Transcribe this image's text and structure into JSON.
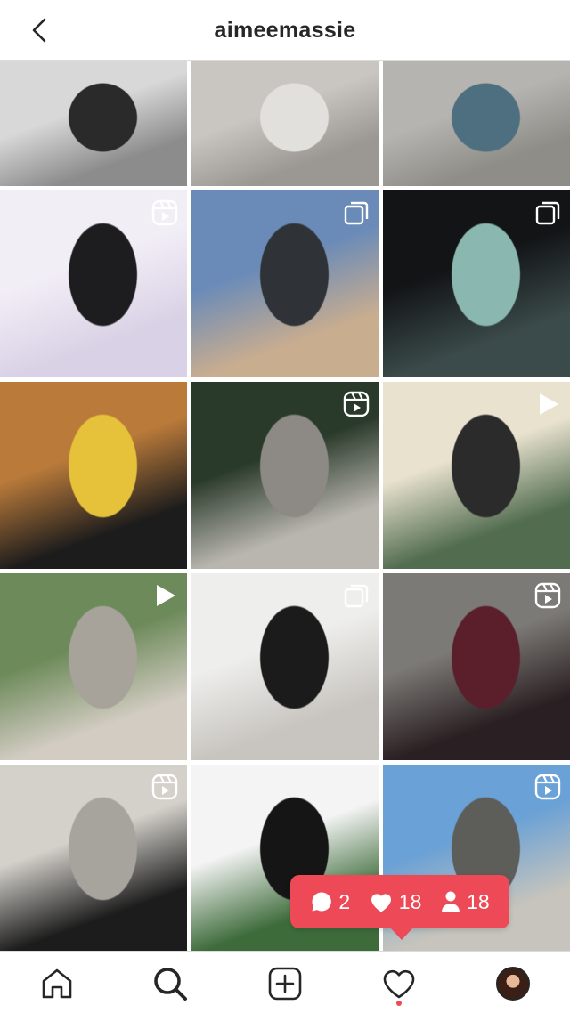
{
  "header": {
    "username": "aimeemassie",
    "back_icon": "chevron-left-icon"
  },
  "posts": [
    {
      "id": "post-1",
      "badge": "none",
      "palette": [
        "#d8d8d8",
        "#8c8c8c",
        "#2a2a2a"
      ]
    },
    {
      "id": "post-2",
      "badge": "none",
      "palette": [
        "#c9c6c1",
        "#9b9792",
        "#e2e0dc"
      ]
    },
    {
      "id": "post-3",
      "badge": "none",
      "palette": [
        "#b5b4b0",
        "#8e8d88",
        "#4d6f7f"
      ]
    },
    {
      "id": "post-4",
      "badge": "reel",
      "palette": [
        "#f2eef6",
        "#d9d2e6",
        "#1d1d1f"
      ]
    },
    {
      "id": "post-5",
      "badge": "carousel",
      "palette": [
        "#6a8bb8",
        "#c9ad8f",
        "#2f3338"
      ]
    },
    {
      "id": "post-6",
      "badge": "carousel",
      "palette": [
        "#121416",
        "#3b4a4a",
        "#8ab7b0"
      ]
    },
    {
      "id": "post-7",
      "badge": "none",
      "palette": [
        "#b97a3a",
        "#1c1c1c",
        "#e6c23b"
      ]
    },
    {
      "id": "post-8",
      "badge": "reel",
      "palette": [
        "#2a3a2a",
        "#b9b6b0",
        "#8d8a86"
      ]
    },
    {
      "id": "post-9",
      "badge": "video",
      "palette": [
        "#e9e2cf",
        "#516c4f",
        "#2b2b2b"
      ]
    },
    {
      "id": "post-10",
      "badge": "video",
      "palette": [
        "#6d8a5a",
        "#d2ccc2",
        "#a8a39a"
      ]
    },
    {
      "id": "post-11",
      "badge": "carousel",
      "palette": [
        "#eeeeec",
        "#c8c5c0",
        "#1b1b1b"
      ]
    },
    {
      "id": "post-12",
      "badge": "reel",
      "palette": [
        "#7c7a76",
        "#2a1f22",
        "#5a1f2a"
      ]
    },
    {
      "id": "post-13",
      "badge": "reel",
      "palette": [
        "#d4d1cb",
        "#1c1c1c",
        "#a7a39d"
      ]
    },
    {
      "id": "post-14",
      "badge": "none",
      "palette": [
        "#f4f4f4",
        "#3d6b3a",
        "#151515"
      ]
    },
    {
      "id": "post-15",
      "badge": "reel",
      "palette": [
        "#6aa1d6",
        "#c6c4bc",
        "#5d5d5a"
      ]
    }
  ],
  "activity_popup": {
    "comments": "2",
    "likes": "18",
    "follows": "18",
    "color": "#ed4956"
  },
  "tabbar": {
    "tabs": [
      "home-icon",
      "search-icon",
      "new-post-icon",
      "activity-heart-icon",
      "profile-avatar"
    ],
    "active": "search-icon",
    "notification_dot_color": "#ed4956"
  }
}
